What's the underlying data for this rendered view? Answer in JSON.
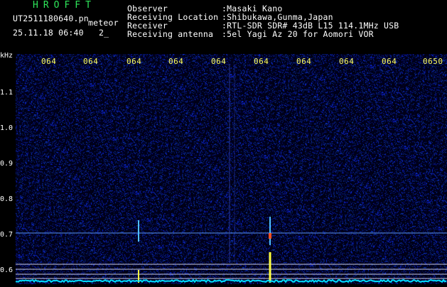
{
  "header": {
    "title": "HROFFT",
    "filename": "UT2511180640.pn",
    "tag": "meteor",
    "date": "25.11.18 06:40",
    "date_suffix": "2_",
    "info": [
      {
        "label": "Observer",
        "value": ":Masaki Kano"
      },
      {
        "label": "Receiving Location",
        "value": ":Shibukawa,Gunma,Japan"
      },
      {
        "label": "Receiver",
        "value": ":RTL-SDR SDR# 43dB L15 114.1MHz USB"
      },
      {
        "label": "Receiving antenna",
        "value": ":5el Yagi Az 20 for Aomori VOR"
      }
    ]
  },
  "axes": {
    "y_unit": "kHz",
    "y_ticks": [
      "1.1",
      "1.0",
      "0.9",
      "0.8",
      "0.7",
      "0.6"
    ],
    "x_ticks": [
      "064",
      "064",
      "064",
      "064",
      "064",
      "064",
      "064",
      "064",
      "064",
      "0650"
    ]
  },
  "colors": {
    "background": "#000000",
    "noise_dark": "#000012",
    "noise_blue": "#1a2a9e",
    "trace": "#00e0ff",
    "meteor": "#ffff40",
    "title": "#2ee65a",
    "tick_label": "#ffff60"
  }
}
